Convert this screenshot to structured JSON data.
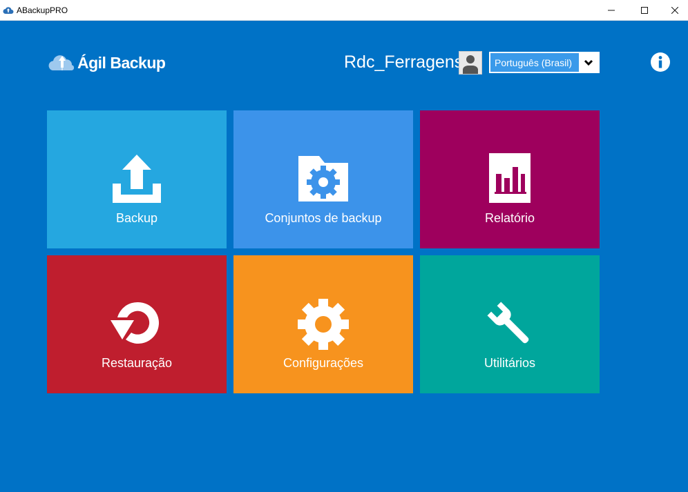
{
  "window": {
    "title": "ABackupPRO",
    "minimize": "—",
    "maximize": "☐",
    "close": "✕"
  },
  "header": {
    "logo_text": "Ágil Backup",
    "user_name": "Rdc_Ferragens",
    "language": "Português (Brasil)"
  },
  "tiles": [
    {
      "label": "Backup",
      "color": "#25a7e0",
      "icon": "upload-icon"
    },
    {
      "label": "Conjuntos de backup",
      "color": "#3c93ea",
      "icon": "folder-gear-icon"
    },
    {
      "label": "Relatório",
      "color": "#9e005d",
      "icon": "report-chart-icon"
    },
    {
      "label": "Restauração",
      "color": "#bf1e2e",
      "icon": "restore-icon"
    },
    {
      "label": "Configurações",
      "color": "#f7931e",
      "icon": "gear-icon"
    },
    {
      "label": "Utilitários",
      "color": "#00a69c",
      "icon": "wrench-icon"
    }
  ],
  "colors": {
    "background": "#0072c6",
    "language_select": "#3a9aea"
  }
}
